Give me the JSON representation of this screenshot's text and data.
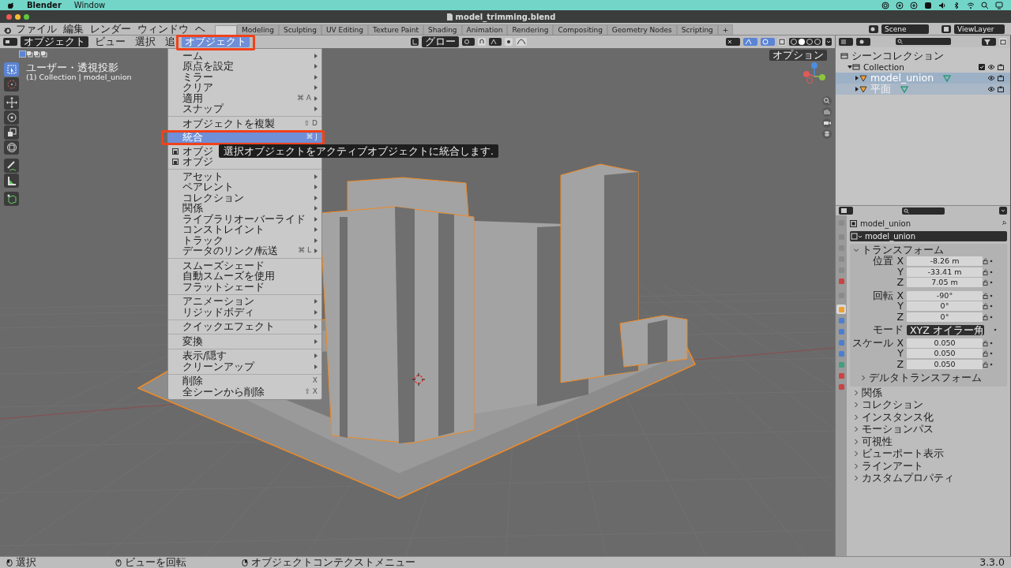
{
  "mac_menubar": {
    "app": "Blender",
    "menus": [
      "Window"
    ]
  },
  "window": {
    "title": "model_trimming.blend"
  },
  "topbar": {
    "menus": [
      "ファイル",
      "編集",
      "レンダー",
      "ウィンドウ",
      "ヘ"
    ],
    "workspace_tabs": [
      {
        "selected": true
      },
      {
        "label": "Modeling",
        "selected": false
      },
      {
        "label": "Sculpting",
        "selected": false
      },
      {
        "label": "UV Editing",
        "selected": false
      },
      {
        "label": "Texture Paint",
        "selected": false
      },
      {
        "label": "Shading",
        "selected": false
      },
      {
        "label": "Animation",
        "selected": false
      },
      {
        "label": "Rendering",
        "selected": false
      },
      {
        "label": "Compositing",
        "selected": false
      },
      {
        "label": "Geometry Nodes",
        "selected": false
      },
      {
        "label": "Scripting",
        "selected": false
      }
    ],
    "add_tab": "+",
    "scene": "Scene",
    "view_layer": "ViewLayer"
  },
  "viewport_header": {
    "mode": "オブジェクト",
    "menus": [
      {
        "label": "ビュー",
        "selected": false
      },
      {
        "label": "選択",
        "selected": false
      },
      {
        "label": "追",
        "selected": false
      },
      {
        "label": "オブジェクト",
        "selected": true
      }
    ],
    "orientation": "グロー",
    "shading_modes": [
      {
        "selected": false
      },
      {
        "selected": true
      },
      {
        "selected": false
      },
      {
        "selected": false
      }
    ]
  },
  "viewport": {
    "view_name": "ユーザー・透視投影",
    "context": "(1) Collection | model_union",
    "options_button": "オプション",
    "tools": [
      {
        "kind": "select",
        "selected": true
      },
      {
        "kind": "cursor",
        "selected": false
      },
      {
        "kind": "move",
        "selected": false
      },
      {
        "kind": "rotate",
        "selected": false
      },
      {
        "kind": "scale",
        "selected": false
      },
      {
        "kind": "transform",
        "selected": false
      },
      {
        "kind": "annotate",
        "selected": false
      },
      {
        "kind": "measure",
        "selected": false
      },
      {
        "kind": "add-cube",
        "selected": false
      }
    ]
  },
  "object_menu": {
    "sections": [
      [
        {
          "label": "ーム",
          "submenu": true,
          "selected": false
        },
        {
          "label": "原点を設定",
          "submenu": true,
          "selected": false
        },
        {
          "label": "ミラー",
          "submenu": true,
          "selected": false
        },
        {
          "label": "クリア",
          "submenu": true,
          "selected": false
        },
        {
          "label": "適用",
          "shortcut": "⌘ A",
          "submenu": true,
          "selected": false
        },
        {
          "label": "スナップ",
          "submenu": true,
          "selected": false
        }
      ],
      [
        {
          "label": "オブジェクトを複製",
          "shortcut": "⇧ D",
          "submenu": false,
          "selected": false
        },
        {
          "label": "統合",
          "shortcut": "⌘ J",
          "submenu": false,
          "selected": true
        },
        {
          "label": "オブジ",
          "icon": true,
          "submenu": false,
          "selected": false
        },
        {
          "label": "オブジ",
          "icon": true,
          "submenu": false,
          "selected": false
        }
      ],
      [
        {
          "label": "アセット",
          "submenu": true,
          "selected": false
        },
        {
          "label": "ペアレント",
          "submenu": true,
          "selected": false
        },
        {
          "label": "コレクション",
          "submenu": true,
          "selected": false
        },
        {
          "label": "関係",
          "submenu": true,
          "selected": false
        },
        {
          "label": "ライブラリオーバーライド",
          "submenu": true,
          "selected": false
        },
        {
          "label": "コンストレイント",
          "submenu": true,
          "selected": false
        },
        {
          "label": "トラック",
          "submenu": true,
          "selected": false
        },
        {
          "label": "データのリンク/転送",
          "shortcut": "⌘ L",
          "submenu": true,
          "selected": false
        }
      ],
      [
        {
          "label": "スムーズシェード",
          "submenu": false,
          "selected": false
        },
        {
          "label": "自動スムーズを使用",
          "submenu": false,
          "selected": false
        },
        {
          "label": "フラットシェード",
          "submenu": false,
          "selected": false
        }
      ],
      [
        {
          "label": "アニメーション",
          "submenu": true,
          "selected": false
        },
        {
          "label": "リジッドボディ",
          "submenu": true,
          "selected": false
        }
      ],
      [
        {
          "label": "クイックエフェクト",
          "submenu": true,
          "selected": false
        }
      ],
      [
        {
          "label": "変換",
          "submenu": true,
          "selected": false
        }
      ],
      [
        {
          "label": "表示/隠す",
          "submenu": true,
          "selected": false
        },
        {
          "label": "クリーンアップ",
          "submenu": true,
          "selected": false
        }
      ],
      [
        {
          "label": "削除",
          "shortcut": "X",
          "submenu": false,
          "selected": false
        },
        {
          "label": "全シーンから削除",
          "shortcut": "⇧ X",
          "submenu": false,
          "selected": false
        }
      ]
    ]
  },
  "tooltip": "選択オブジェクトをアクティブオブジェクトに統合します.",
  "outliner": {
    "tree": [
      {
        "label": "シーンコレクション",
        "children": [
          {
            "label": "Collection",
            "expanded": true,
            "checked": true,
            "children": [
              {
                "label": "model_union",
                "selected": true,
                "active": true
              },
              {
                "label": "平面",
                "selected": true,
                "active": false
              }
            ]
          }
        ]
      }
    ]
  },
  "properties": {
    "tabs": [
      {
        "color": "#8a8a8a",
        "selected": false
      },
      {
        "color": "#8a8a8a",
        "selected": false
      },
      {
        "color": "#8a8a8a",
        "selected": false
      },
      {
        "color": "#8a8a8a",
        "selected": false
      },
      {
        "color": "#8a8a8a",
        "selected": false
      },
      {
        "color": "#c94444",
        "selected": false
      },
      {
        "color": "#8a8a8a",
        "selected": false
      },
      {
        "color": "#f0a030",
        "selected": true
      },
      {
        "color": "#4a7fd0",
        "selected": false
      },
      {
        "color": "#4a7fd0",
        "selected": false
      },
      {
        "color": "#4a7fd0",
        "selected": false
      },
      {
        "color": "#4a7fd0",
        "selected": false
      },
      {
        "color": "#40a080",
        "selected": false
      },
      {
        "color": "#c94444",
        "selected": false
      },
      {
        "color": "#c94444",
        "selected": false
      }
    ],
    "object_name": "model_union",
    "name_field": "model_union",
    "transform": {
      "title": "トランスフォーム",
      "expanded": true,
      "groups": [
        [
          {
            "kind": "number",
            "label": "位置 X",
            "value": "-8.26 m"
          },
          {
            "kind": "number",
            "label": "Y",
            "value": "-33.41 m"
          },
          {
            "kind": "number",
            "label": "Z",
            "value": "7.05 m"
          }
        ],
        [
          {
            "kind": "number",
            "label": "回転 X",
            "value": "-90°"
          },
          {
            "kind": "number",
            "label": "Y",
            "value": "0°"
          },
          {
            "kind": "number",
            "label": "Z",
            "value": "0°"
          }
        ],
        [
          {
            "kind": "dropdown",
            "label": "モード",
            "value": "XYZ オイラー角"
          }
        ],
        [
          {
            "kind": "number",
            "label": "スケール X",
            "value": "0.050"
          },
          {
            "kind": "number",
            "label": "Y",
            "value": "0.050"
          },
          {
            "kind": "number",
            "label": "Z",
            "value": "0.050"
          }
        ]
      ],
      "subpanel": {
        "title": "デルタトランスフォーム",
        "expanded": false
      }
    },
    "panels": [
      {
        "title": "関係",
        "expanded": false
      },
      {
        "title": "コレクション",
        "expanded": false
      },
      {
        "title": "インスタンス化",
        "expanded": false
      },
      {
        "title": "モーションパス",
        "expanded": false
      },
      {
        "title": "可視性",
        "expanded": false
      },
      {
        "title": "ビューポート表示",
        "expanded": false
      },
      {
        "title": "ラインアート",
        "expanded": false
      },
      {
        "title": "カスタムプロパティ",
        "expanded": false
      }
    ]
  },
  "status_bar": {
    "items": [
      "選択",
      "ビューを回転",
      "オブジェクトコンテクストメニュー"
    ],
    "version": "3.3.0"
  }
}
